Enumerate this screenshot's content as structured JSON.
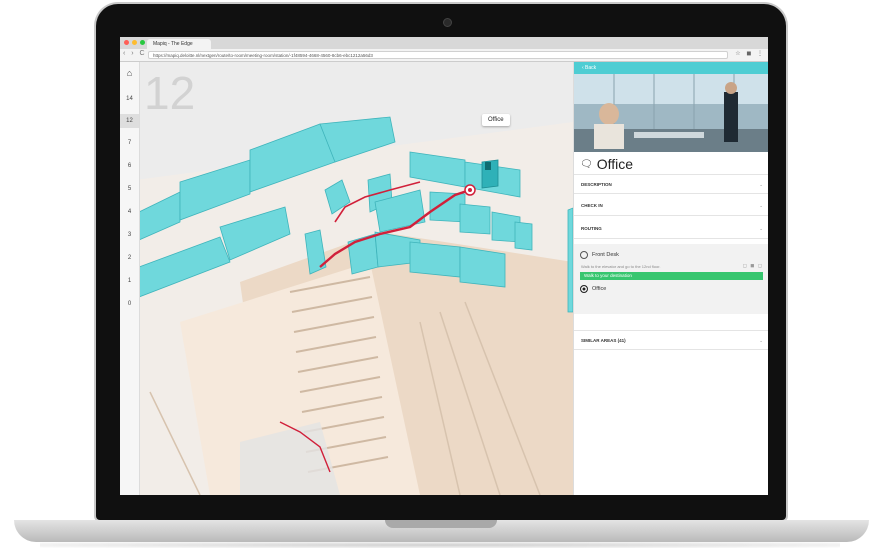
{
  "browser": {
    "tab_title": "Mapiq - The Edge",
    "url": "https://mapiq.deloitte.nl/nextgen/route/to-room/meeting-room/station/-1f48594-4668-4560-8cb6-ebc1212a56d3",
    "nav_icons": "‹ › C",
    "tool_icons": "☆ ◼ ⋮"
  },
  "floors": {
    "home_icon": "⌂",
    "items": [
      "14",
      "12",
      "7",
      "6",
      "5",
      "4",
      "3",
      "2",
      "1",
      "0"
    ],
    "active": "12"
  },
  "map": {
    "current_floor": "12",
    "tooltip": "Office"
  },
  "panel": {
    "back_label": "‹ Back",
    "title": "Office",
    "sections": {
      "description": "DESCRIPTION",
      "check_in": "CHECK IN",
      "routing": "ROUTING",
      "similar": "SIMILAR AREAS (41)"
    },
    "chevron": "⌄",
    "routing": {
      "origin": "Front Desk",
      "instruction": "Walk to the elevator and go to the 12nd floor.",
      "icons": "◻ ◼ ◻",
      "step": "Walk to your destination",
      "destination": "Office"
    }
  },
  "colors": {
    "accent": "#4ecdd3",
    "room": "#6fd8dc",
    "route": "#d1203a",
    "success": "#37c66f"
  }
}
